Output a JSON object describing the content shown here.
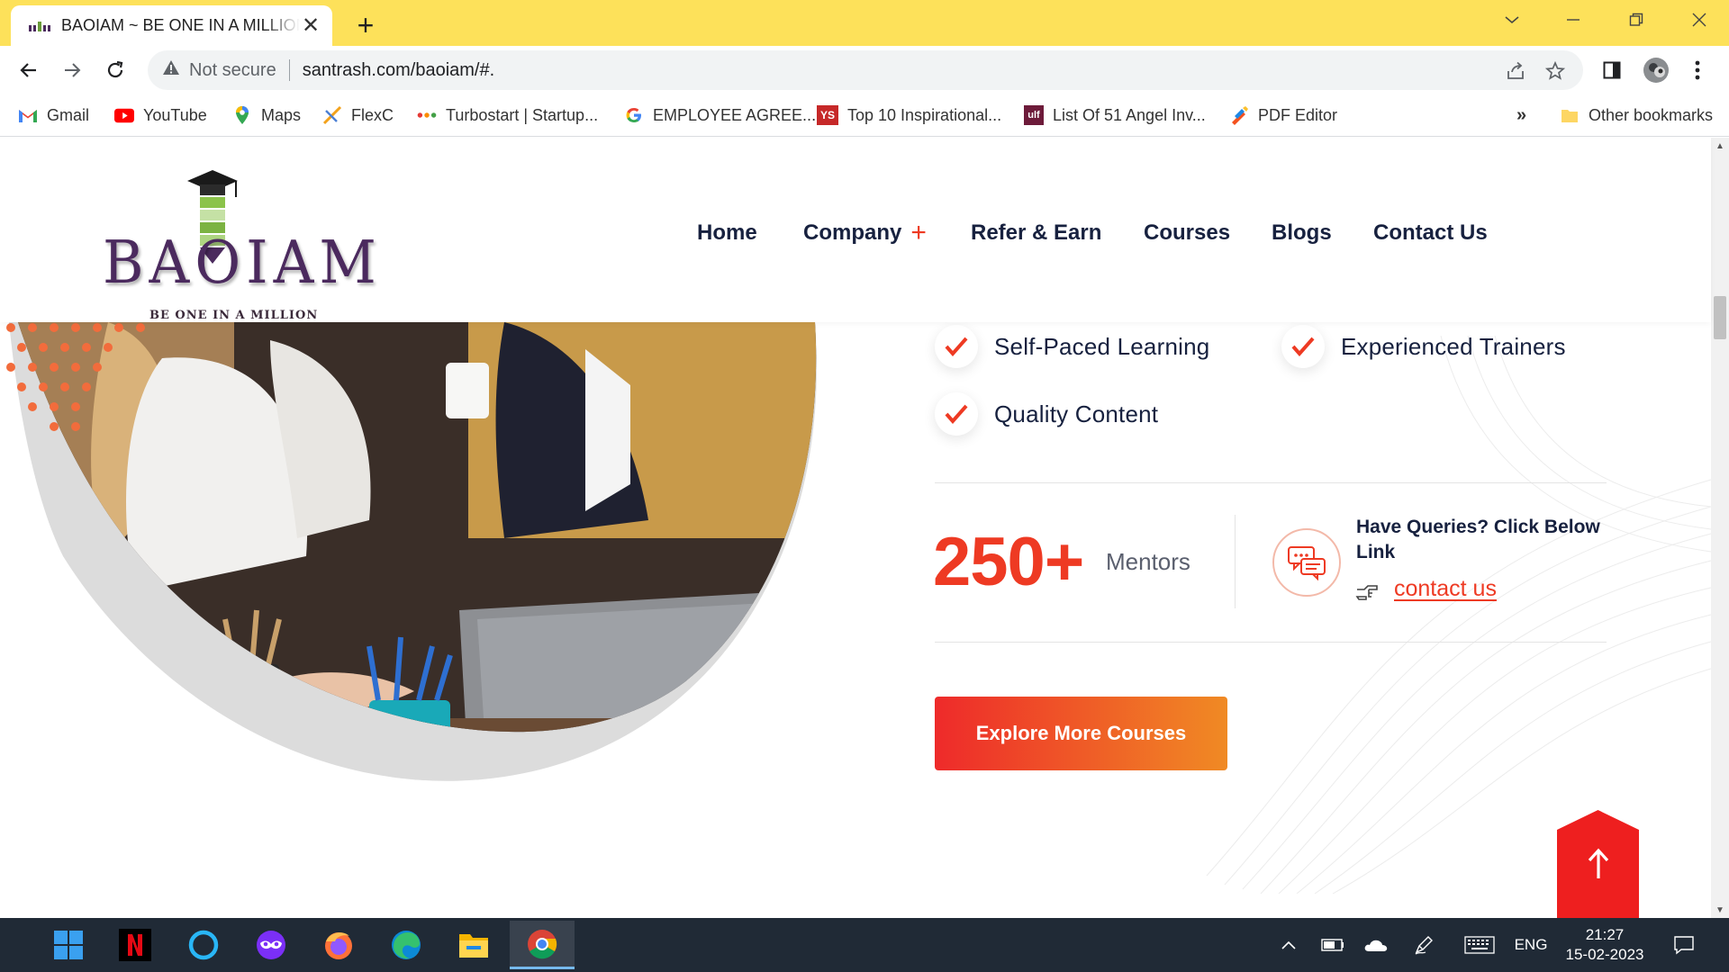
{
  "browser": {
    "tab": {
      "title": "BAOIAM ~ BE ONE IN A MILLION",
      "favicon": "baoiam-logo-icon",
      "close_icon": "close-icon"
    },
    "new_tab": "+",
    "window_controls": [
      "chevron-down-icon",
      "minimize-icon",
      "restore-icon",
      "close-icon"
    ],
    "omnibox": {
      "security_label": "Not secure",
      "url": "santrash.com/baoiam/#."
    },
    "bookmarks": [
      {
        "label": "Gmail",
        "icon": "gmail-icon"
      },
      {
        "label": "YouTube",
        "icon": "youtube-icon"
      },
      {
        "label": "Maps",
        "icon": "maps-icon"
      },
      {
        "label": "FlexC",
        "icon": "flexc-icon"
      },
      {
        "label": "Turbostart | Startup...",
        "icon": "turbostart-icon"
      },
      {
        "label": "EMPLOYEE AGREE...",
        "icon": "google-icon"
      },
      {
        "label": "Top 10 Inspirational...",
        "icon": "yourstory-icon"
      },
      {
        "label": "List Of 51 Angel Inv...",
        "icon": "site-icon"
      },
      {
        "label": "PDF Editor",
        "icon": "pdf-editor-icon"
      }
    ],
    "bookmarks_overflow": "»",
    "other_bookmarks": "Other bookmarks"
  },
  "site": {
    "logo": {
      "word": "BAOIAM",
      "tagline": "BE ONE IN A MILLION"
    },
    "nav": {
      "home": "Home",
      "company": "Company",
      "company_plus": "+",
      "refer": "Refer & Earn",
      "courses": "Courses",
      "blogs": "Blogs",
      "contact": "Contact Us"
    },
    "features": [
      "Self-Paced Learning",
      "Experienced Trainers",
      "Quality Content"
    ],
    "stat": {
      "number": "250",
      "plus": "+",
      "label": "Mentors"
    },
    "queries": {
      "title": "Have Queries? Click Below Link",
      "link": "contact us"
    },
    "cta": "Explore More Courses",
    "to_top_icon": "arrow-up-icon"
  },
  "taskbar": {
    "apps": [
      "windows-start-icon",
      "netflix-icon",
      "cortana-icon",
      "vpn-mask-icon",
      "firefox-icon",
      "edge-icon",
      "file-explorer-icon",
      "chrome-icon"
    ],
    "language": "ENG",
    "time": "21:27",
    "date": "15-02-2023"
  },
  "colors": {
    "tab_strip": "#fde15a",
    "brand_red": "#ee3a23",
    "brand_orange": "#f08a24",
    "nav_text": "#17213f",
    "taskbar": "#202a36"
  }
}
